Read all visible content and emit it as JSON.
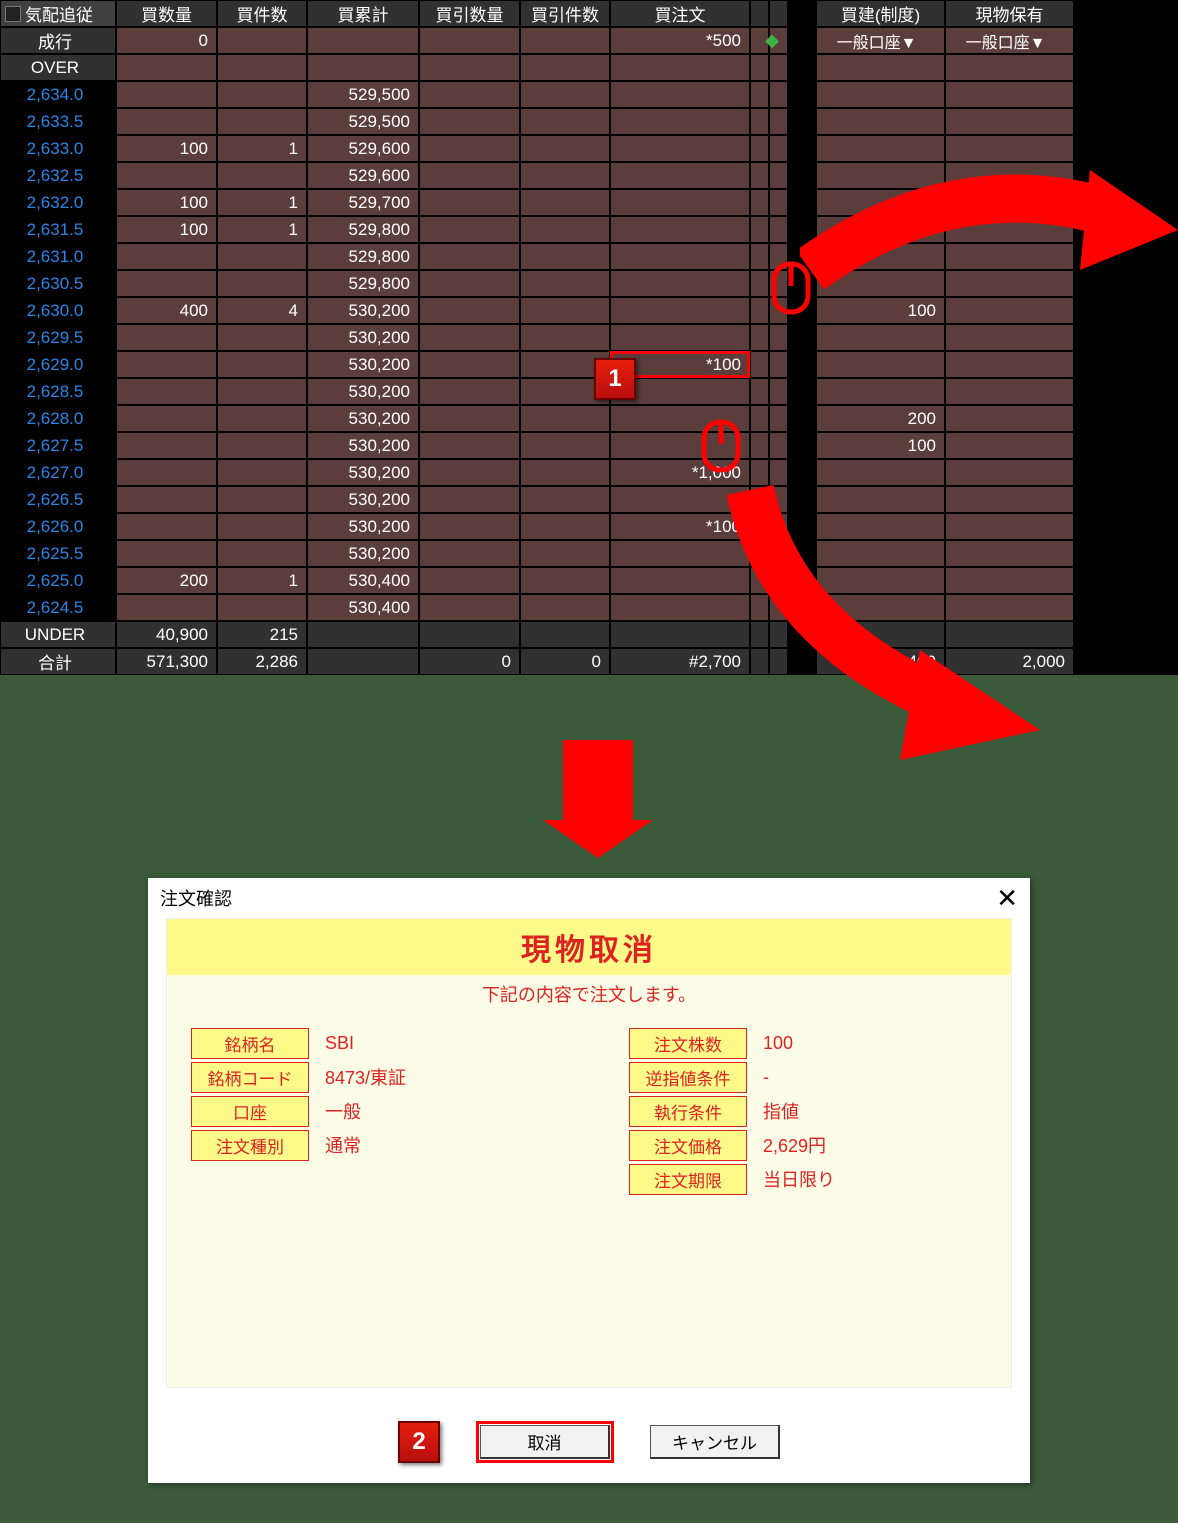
{
  "board": {
    "track_label": "気配追従",
    "headers": [
      "買数量",
      "買件数",
      "買累計",
      "買引数量",
      "買引件数",
      "買注文",
      "買建(制度)",
      "現物保有"
    ],
    "market_row_label": "成行",
    "over_label": "OVER",
    "under_label": "UNDER",
    "total_label": "合計",
    "account_selector": "一般口座▼",
    "market_row": {
      "qty": "0",
      "order": "*500"
    },
    "rows": [
      {
        "price": "2,634.0",
        "cum": "529,500"
      },
      {
        "price": "2,633.5",
        "cum": "529,500"
      },
      {
        "price": "2,633.0",
        "qty": "100",
        "cnt": "1",
        "cum": "529,600"
      },
      {
        "price": "2,632.5",
        "cum": "529,600"
      },
      {
        "price": "2,632.0",
        "qty": "100",
        "cnt": "1",
        "cum": "529,700"
      },
      {
        "price": "2,631.5",
        "qty": "100",
        "cnt": "1",
        "cum": "529,800"
      },
      {
        "price": "2,631.0",
        "cum": "529,800"
      },
      {
        "price": "2,630.5",
        "cum": "529,800"
      },
      {
        "price": "2,630.0",
        "qty": "400",
        "cnt": "4",
        "cum": "530,200",
        "pos": "100"
      },
      {
        "price": "2,629.5",
        "cum": "530,200"
      },
      {
        "price": "2,629.0",
        "cum": "530,200",
        "order": "*100",
        "hl": true
      },
      {
        "price": "2,628.5",
        "cum": "530,200"
      },
      {
        "price": "2,628.0",
        "cum": "530,200",
        "pos": "200"
      },
      {
        "price": "2,627.5",
        "cum": "530,200",
        "pos": "100"
      },
      {
        "price": "2,627.0",
        "cum": "530,200",
        "order": "*1,000"
      },
      {
        "price": "2,626.5",
        "cum": "530,200"
      },
      {
        "price": "2,626.0",
        "cum": "530,200",
        "order": "*100"
      },
      {
        "price": "2,625.5",
        "cum": "530,200"
      },
      {
        "price": "2,625.0",
        "qty": "200",
        "cnt": "1",
        "cum": "530,400"
      },
      {
        "price": "2,624.5",
        "cum": "530,400"
      }
    ],
    "under": {
      "qty": "40,900",
      "cnt": "215"
    },
    "total": {
      "qty": "571,300",
      "cnt": "2,286",
      "pullqty": "0",
      "pullcnt": "0",
      "order": "#2,700",
      "pos": "1,400",
      "hold": "2,000"
    }
  },
  "steps": {
    "one": "1",
    "two": "2"
  },
  "dialog": {
    "title": "注文確認",
    "main": "現物取消",
    "sub": "下記の内容で注文します。",
    "left": [
      {
        "lab": "銘柄名",
        "val": "SBI"
      },
      {
        "lab": "銘柄コード",
        "val": "8473/東証"
      },
      {
        "lab": "口座",
        "val": "一般"
      },
      {
        "lab": "注文種別",
        "val": "通常"
      }
    ],
    "right": [
      {
        "lab": "注文株数",
        "val": "100"
      },
      {
        "lab": "逆指値条件",
        "val": "-"
      },
      {
        "lab": "執行条件",
        "val": "指値"
      },
      {
        "lab": "注文価格",
        "val": "2,629円"
      },
      {
        "lab": "注文期限",
        "val": "当日限り"
      }
    ],
    "btn_primary": "取消",
    "btn_cancel": "キャンセル"
  }
}
